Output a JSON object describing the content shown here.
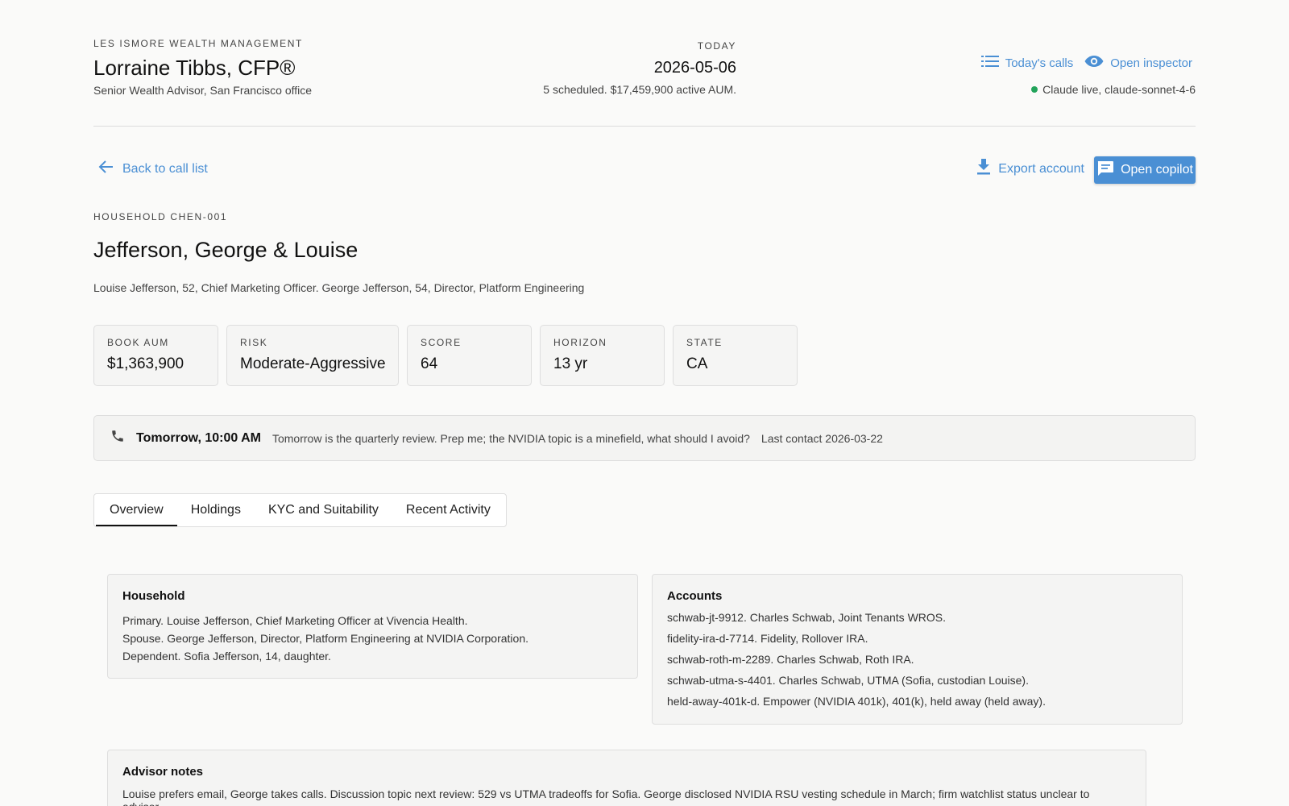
{
  "header": {
    "firm": "LES ISMORE WEALTH MANAGEMENT",
    "advisor_name": "Lorraine Tibbs, CFP®",
    "advisor_title": "Senior Wealth Advisor, San Francisco office",
    "today_label": "TODAY",
    "today_date": "2026-05-06",
    "today_summary": "5 scheduled. $17,459,900 active AUM.",
    "links": {
      "calls": "Today's calls",
      "inspector": "Open inspector"
    },
    "status": "Claude live, claude-sonnet-4-6",
    "status_color": "#22a35a"
  },
  "actions": {
    "back": "Back to call list",
    "export": "Export account",
    "copilot": "Open copilot"
  },
  "household": {
    "id": "HOUSEHOLD CHEN-001",
    "name": "Jefferson, George & Louise",
    "description": "Louise Jefferson, 52, Chief Marketing Officer. George Jefferson, 54, Director, Platform Engineering"
  },
  "stats": [
    {
      "label": "BOOK AUM",
      "value": "$1,363,900"
    },
    {
      "label": "RISK",
      "value": "Moderate-Aggressive"
    },
    {
      "label": "SCORE",
      "value": "64"
    },
    {
      "label": "HORIZON",
      "value": "13 yr"
    },
    {
      "label": "STATE",
      "value": "CA"
    }
  ],
  "call": {
    "when": "Tomorrow, 10:00 AM",
    "message": "Tomorrow is the quarterly review. Prep me; the NVIDIA topic is a minefield, what should I avoid?",
    "last_contact": "Last contact 2026-03-22"
  },
  "tabs": [
    "Overview",
    "Holdings",
    "KYC and Suitability",
    "Recent Activity"
  ],
  "overview": {
    "household_title": "Household",
    "household_lines": [
      "Primary. Louise Jefferson, Chief Marketing Officer at Vivencia Health.",
      "Spouse. George Jefferson, Director, Platform Engineering at NVIDIA Corporation.",
      "Dependent. Sofia Jefferson, 14, daughter."
    ],
    "accounts_title": "Accounts",
    "accounts": [
      "schwab-jt-9912. Charles Schwab, Joint Tenants WROS.",
      "fidelity-ira-d-7714. Fidelity, Rollover IRA.",
      "schwab-roth-m-2289. Charles Schwab, Roth IRA.",
      "schwab-utma-s-4401. Charles Schwab, UTMA (Sofia, custodian Louise).",
      "held-away-401k-d. Empower (NVIDIA 401k), 401(k), held away (held away)."
    ],
    "notes_title": "Advisor notes",
    "notes": "Louise prefers email, George takes calls. Discussion topic next review: 529 vs UTMA tradeoffs for Sofia. George disclosed NVIDIA RSU vesting schedule in March; firm watchlist status unclear to advisor."
  },
  "accent_color": "#4a8fd4"
}
